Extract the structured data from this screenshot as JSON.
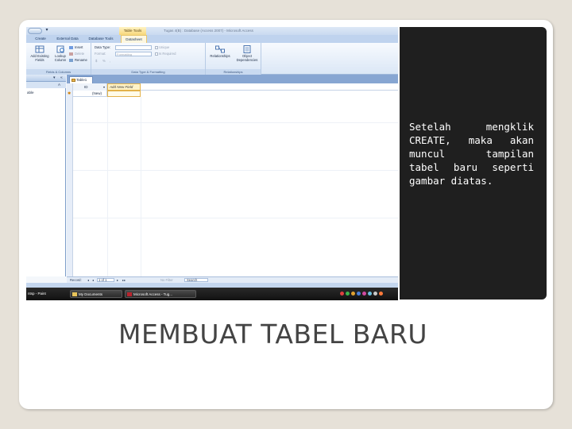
{
  "app": {
    "context_tab_title": "Table Tools",
    "window_title": "Tugas 4(B) : Database (Access 2007) - Microsoft Access",
    "qat_menu_glyph": "▾"
  },
  "ribbon": {
    "tabs": [
      {
        "label": "Create",
        "active": false
      },
      {
        "label": "External Data",
        "active": false
      },
      {
        "label": "Database Tools",
        "active": false
      },
      {
        "label": "Datasheet",
        "active": true
      }
    ],
    "groups": {
      "fields_columns": {
        "label": "Fields & Columns",
        "add_existing_fields": "Add Existing Fields",
        "lookup_column": "Lookup Column",
        "insert": "Insert",
        "delete": "Delete",
        "rename": "Rename"
      },
      "data_type_formatting": {
        "label": "Data Type & Formatting",
        "data_type_label": "Data Type:",
        "format_label": "Format:",
        "format_value": "Formatting",
        "currency": "$",
        "percent": "%",
        "comma": ",",
        "unique": "Unique",
        "is_required": "Is Required"
      },
      "relationships": {
        "label": "Relationships",
        "relationships": "Relationships",
        "object_dependencies": "Object Dependencies"
      }
    }
  },
  "nav_pane": {
    "dropdown_glyph": "▾",
    "collapse_glyph": "«",
    "sort_glyph": "A",
    "item": "able"
  },
  "document": {
    "tab": "Table1",
    "columns": {
      "id": "ID",
      "id_arrow": "▾",
      "add_new_field": "Add New Field"
    },
    "new_row": {
      "marker": "✱",
      "value": "(New)"
    }
  },
  "record_nav": {
    "label": "Record:",
    "first": "◂",
    "prev": "◂",
    "position": "1 of 1",
    "next": "▸",
    "last": "▸▸",
    "filter": "No Filter",
    "search": "Search"
  },
  "taskbar": {
    "items": [
      "ntsp - Paint",
      "My Documents",
      "Microsoft Access - Tug..."
    ]
  },
  "caption": "Setelah mengklik CREATE, maka akan muncul tampilan tabel baru seperti gambar diatas.",
  "slide_title": "MEMBUAT TABEL BARU"
}
